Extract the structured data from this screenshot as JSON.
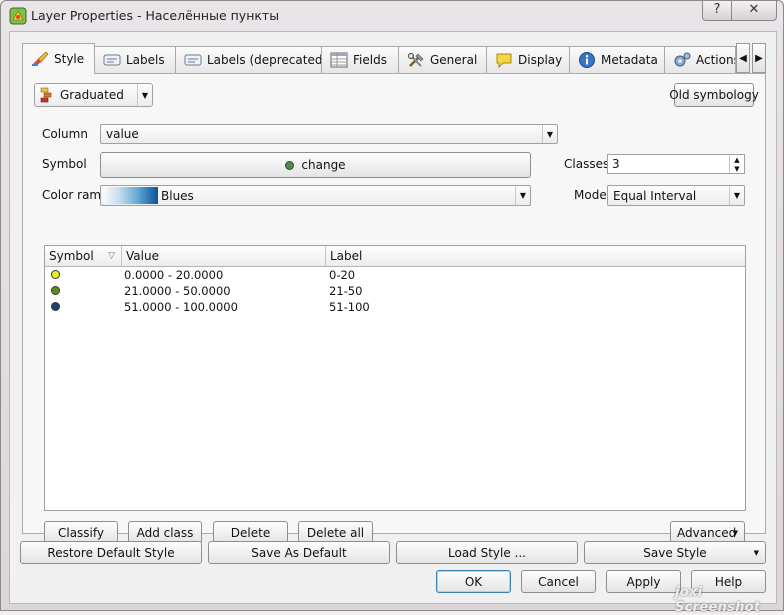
{
  "window": {
    "title": "Layer Properties - Населённые пункты",
    "help_label": "?",
    "close_label": "✕"
  },
  "tabs": [
    {
      "label": "Style",
      "icon": "brush-icon"
    },
    {
      "label": "Labels",
      "icon": "labels-icon"
    },
    {
      "label": "Labels (deprecated)",
      "icon": "labels-deprecated-icon"
    },
    {
      "label": "Fields",
      "icon": "fields-table-icon"
    },
    {
      "label": "General",
      "icon": "tools-icon"
    },
    {
      "label": "Display",
      "icon": "speech-bubble-icon"
    },
    {
      "label": "Metadata",
      "icon": "info-icon"
    },
    {
      "label": "Actions",
      "icon": "gears-icon"
    }
  ],
  "style": {
    "renderer": "Graduated",
    "old_symbology_label": "Old symbology",
    "column_label": "Column",
    "column_value": "value",
    "symbol_label": "Symbol",
    "symbol_button_label": "change",
    "classes_label": "Classes",
    "classes_value": "3",
    "color_ramp_label": "Color ramp",
    "color_ramp_value": "Blues",
    "mode_label": "Mode",
    "mode_value": "Equal Interval",
    "table": {
      "headers": [
        "Symbol",
        "Value",
        "Label"
      ],
      "rows": [
        {
          "color": "#f0f020",
          "value": "0.0000 - 20.0000",
          "label": "0-20"
        },
        {
          "color": "#5c8a1e",
          "value": "21.0000 - 50.0000",
          "label": "21-50"
        },
        {
          "color": "#1f3f6e",
          "value": "51.0000 - 100.0000",
          "label": "51-100"
        }
      ]
    },
    "buttons": {
      "classify": "Classify",
      "add_class": "Add class",
      "delete": "Delete",
      "delete_all": "Delete all",
      "advanced": "Advanced"
    }
  },
  "footer": {
    "restore_default": "Restore Default Style",
    "save_as_default": "Save As Default",
    "load_style": "Load Style ...",
    "save_style": "Save Style",
    "ok": "OK",
    "cancel": "Cancel",
    "apply": "Apply",
    "help": "Help"
  },
  "watermark": "joxi Screenshot"
}
